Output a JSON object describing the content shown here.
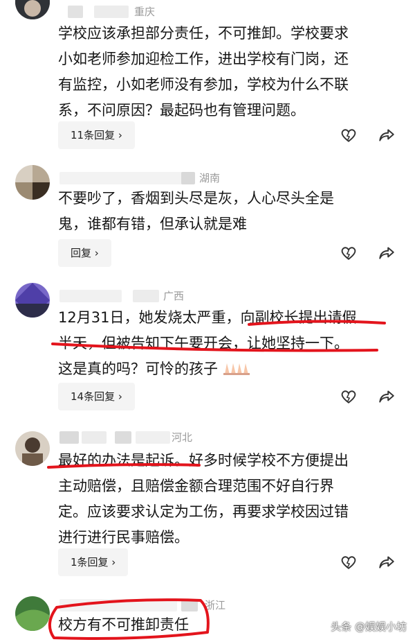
{
  "comments": [
    {
      "location": "重庆",
      "lines": [
        "学校应该承担部分责任，不可推卸。学校要求",
        "小如老师参加迎检工作，进出学校有门岗，还",
        "有监控，小如老师没有参加，学校为什么不联",
        "系，不问原因？最起码也有管理问题。"
      ],
      "reply_label": "11条回复 ›"
    },
    {
      "location": "湖南",
      "lines": [
        "不要吵了，香烟到头尽是灰，人心尽头全是",
        "鬼，谁都有错，但承认就是难"
      ],
      "reply_label": "回复 ›"
    },
    {
      "location": "广西",
      "lines": [
        "12月31日，她发烧太严重，向副校长提出请假",
        "半天，但被告知下午要开会，让她坚持一下。",
        "这是真的吗？可怜的孩子"
      ],
      "reply_label": "14条回复 ›"
    },
    {
      "location": "河北",
      "lines": [
        "最好的办法是起诉。好多时候学校不方便提出",
        "主动赔偿，且赔偿金额合理范围不好自行界",
        "定。应该要求认定为工伤，再要求学校因过错",
        "进行进行民事赔偿。"
      ],
      "reply_label": "1条回复 ›"
    },
    {
      "location": "浙江",
      "lines": [
        "校方有不可推卸责任"
      ]
    }
  ],
  "watermark": "头条 @娱娱小坊",
  "colors": {
    "underline": "#e3141c",
    "reply_bg": "#f4f4f4",
    "location": "#9a9a9a"
  },
  "icons": [
    "heart-icon",
    "share-icon",
    "praying-hands-emoji"
  ]
}
